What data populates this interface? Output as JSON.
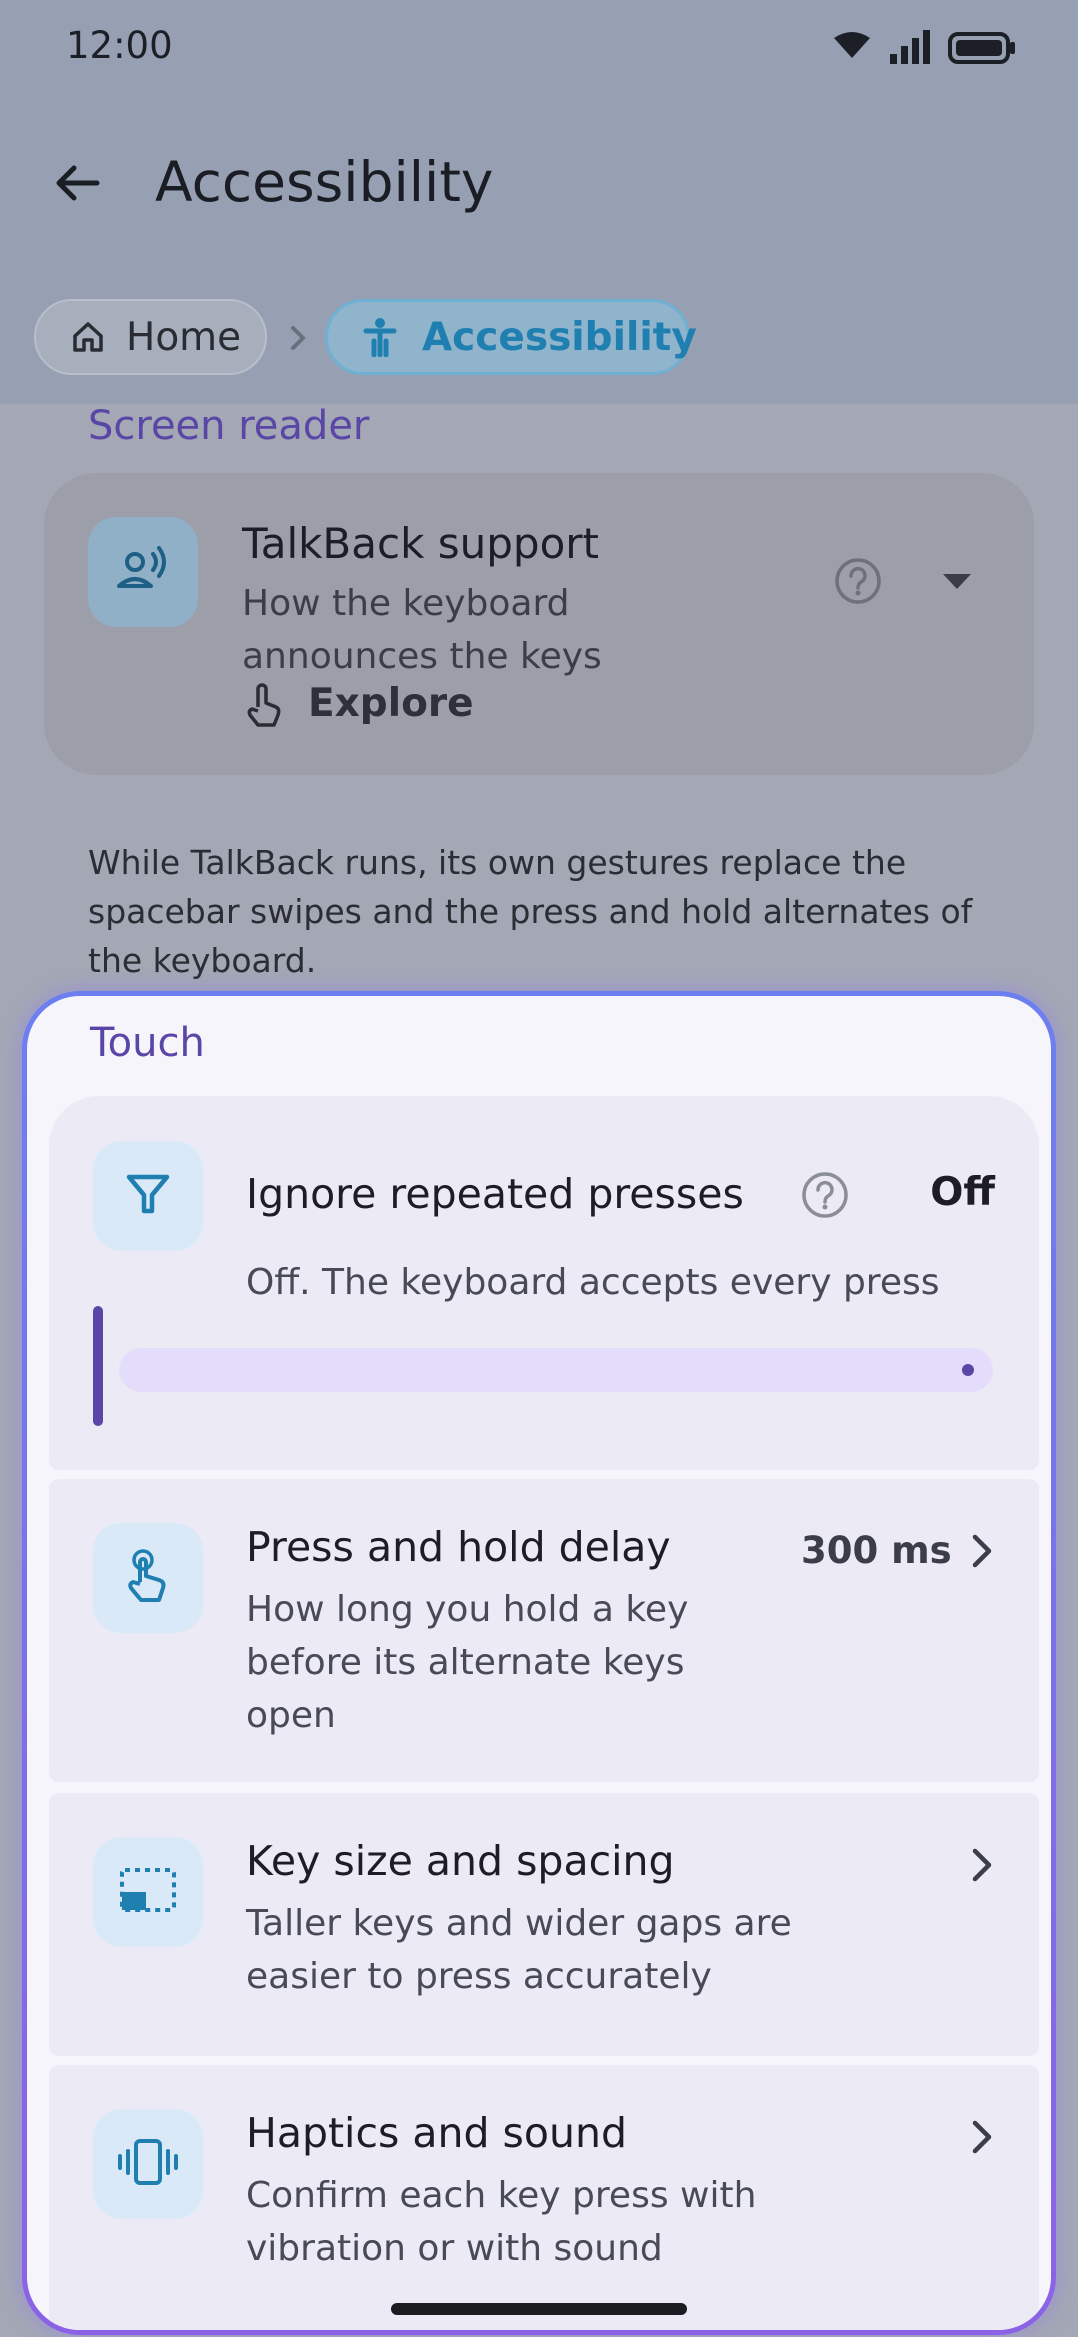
{
  "status_bar": {
    "time": "12:00"
  },
  "header": {
    "title": "Accessibility"
  },
  "breadcrumb": {
    "home": "Home",
    "current": "Accessibility"
  },
  "screen_reader": {
    "heading": "Screen reader",
    "talkback": {
      "title": "TalkBack support",
      "subtitle": "How the keyboard announces the keys",
      "mode": "Explore"
    },
    "note": "While TalkBack runs, its own gestures replace the spacebar swipes and the press and hold alternates of the keyboard."
  },
  "touch": {
    "heading": "Touch",
    "ignore_repeated": {
      "title": "Ignore repeated presses",
      "value": "Off",
      "subtitle": "Off. The keyboard accepts every press",
      "slider_fraction": 0.0
    },
    "hold_delay": {
      "title": "Press and hold delay",
      "value": "300 ms",
      "subtitle": "How long you hold a key before its alternate keys open"
    },
    "key_size": {
      "title": "Key size and spacing",
      "subtitle": "Taller keys and wider gaps are easier to press accurately"
    },
    "haptics": {
      "title": "Haptics and sound",
      "subtitle": "Confirm each key press with vibration or with sound"
    }
  },
  "colors": {
    "accent": "#5a46a6",
    "tile": "#d9e9f7",
    "icon": "#1e7fb0"
  }
}
